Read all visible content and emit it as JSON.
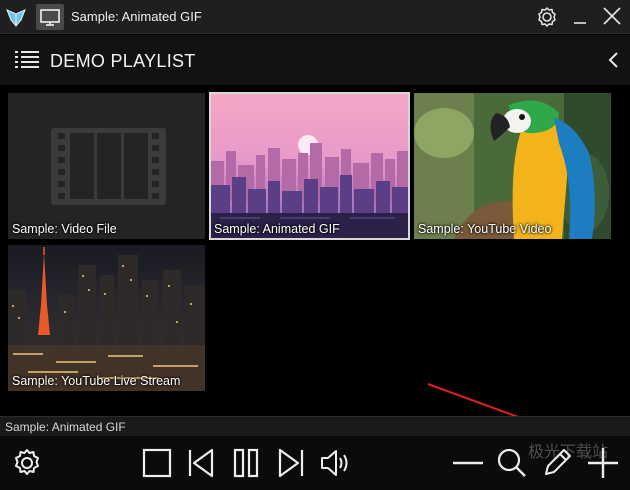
{
  "window": {
    "title": "Sample: Animated GIF",
    "icons": [
      "app-logo-icon",
      "monitor-icon",
      "gear-icon",
      "minimize-icon",
      "close-icon"
    ]
  },
  "playlist": {
    "title": "DEMO PLAYLIST",
    "items": [
      {
        "label": "Sample: Video File",
        "thumbnail": "film-placeholder"
      },
      {
        "label": "Sample: Animated GIF",
        "thumbnail": "pink-city-skyline",
        "selected": true
      },
      {
        "label": "Sample: YouTube Video",
        "thumbnail": "macaw-parrot"
      },
      {
        "label": "Sample: YouTube Live Stream",
        "thumbnail": "night-city-tower"
      }
    ]
  },
  "status": {
    "text": "Sample: Animated GIF"
  },
  "controls": {
    "left": [
      "gear-icon"
    ],
    "center": [
      "stop-icon",
      "previous-icon",
      "pause-icon",
      "next-icon",
      "volume-icon"
    ],
    "right": [
      "zoom-out-icon",
      "search-icon",
      "edit-icon",
      "add-icon"
    ]
  },
  "watermark": "极光下载站",
  "colors": {
    "background": "#000000",
    "titlebar": "#1f1f1f",
    "header": "#121212",
    "selection_outline": "#d8d8d8"
  }
}
